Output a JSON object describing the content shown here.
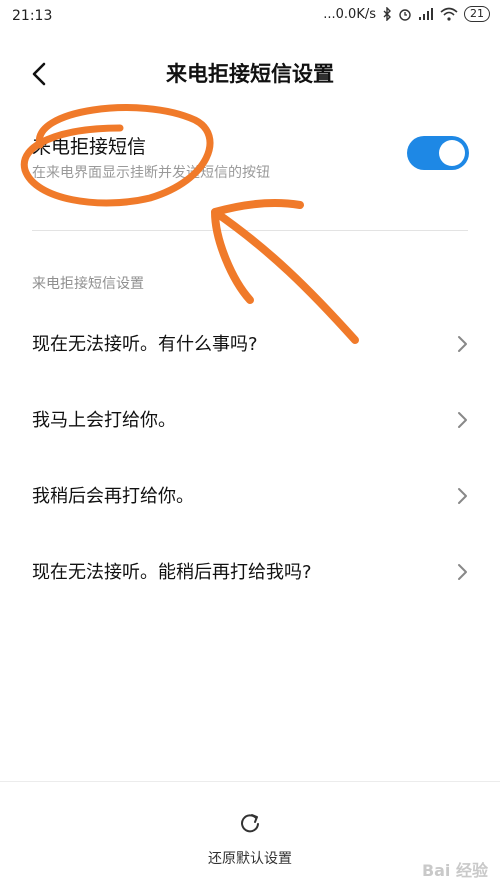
{
  "status_bar": {
    "time": "21:13",
    "network_speed": "...0.0K/s",
    "battery": "21"
  },
  "header": {
    "title": "来电拒接短信设置"
  },
  "toggle": {
    "title": "来电拒接短信",
    "subtitle": "在来电界面显示挂断并发送短信的按钮",
    "enabled": true
  },
  "section": {
    "label": "来电拒接短信设置"
  },
  "messages": [
    "现在无法接听。有什么事吗?",
    "我马上会打给你。",
    "我稍后会再打给你。",
    "现在无法接听。能稍后再打给我吗?"
  ],
  "footer": {
    "reset_label": "还原默认设置"
  },
  "watermark": {
    "text": "Bai 经验"
  },
  "colors": {
    "accent": "#1e88e5",
    "annotation": "#f07a2a"
  }
}
